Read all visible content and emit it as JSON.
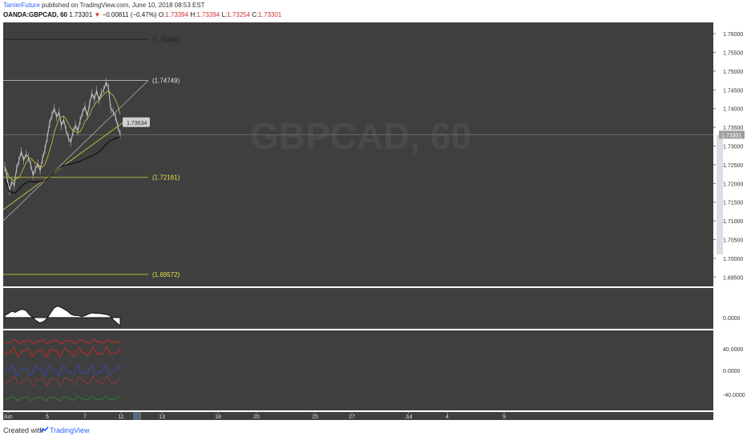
{
  "header": {
    "author": "TarrierFuture",
    "published_text": " published on TradingView.com, June 10, 2018 08:53 EST",
    "symbol": "OANDA:GBPCAD, 60",
    "last": "1.73301",
    "down_arrow": "▼",
    "change": "−0.00811 (−0.47%)",
    "o_label": "O:",
    "o_value": "1.73394",
    "h_label": "H:",
    "h_value": "1.73394",
    "l_label": "L:",
    "l_value": "1.73254",
    "c_label": "C:",
    "c_value": "1.73301"
  },
  "watermark": "GBPCAD, 60",
  "footer": {
    "created_with": "Created with",
    "brand": "TradingView"
  },
  "colors": {
    "bg": "#3f3f3f",
    "candle": "#9a9a9a",
    "yellow": "#c9c93a",
    "ma_dark": "#111111",
    "axis_bg": "#ffffff",
    "indicator_red": "#c62828",
    "indicator_blue": "#3949ab",
    "indicator_green": "#2e7d32"
  },
  "chart_data": {
    "type": "line",
    "title": "",
    "x_ticks": [
      "Jun",
      "5",
      "7",
      "11",
      "13",
      "18",
      "20",
      "25",
      "27",
      "Jul",
      "4",
      "9"
    ],
    "y_ticks": [
      "1.76000",
      "1.75500",
      "1.75000",
      "1.74500",
      "1.74000",
      "1.73500",
      "1.73000",
      "1.72500",
      "1.72000",
      "1.71500",
      "1.71000",
      "1.70500",
      "1.70000",
      "1.69500"
    ],
    "ylim": [
      1.6925,
      1.763
    ],
    "current_price": "1.73301",
    "levels": [
      {
        "label": "(1.75846)",
        "value": 1.75846,
        "color": "dark"
      },
      {
        "label": "(1.74749)",
        "value": 1.74749,
        "color": "light"
      },
      {
        "label": "(1.72161)",
        "value": 1.72161,
        "color": "yellow"
      },
      {
        "label": "(1.69572)",
        "value": 1.69572,
        "color": "yellow"
      }
    ],
    "callout": {
      "label": "1.73634",
      "value": 1.73634
    },
    "series": [
      {
        "values": [
          1.7245,
          1.7215,
          1.718,
          1.7205,
          1.7195,
          1.724,
          1.726,
          1.7285,
          1.7262,
          1.7278,
          1.727,
          1.725,
          1.7222,
          1.7238,
          1.7252,
          1.7235,
          1.7265,
          1.729,
          1.7322,
          1.736,
          1.7382,
          1.74,
          1.7378,
          1.739,
          1.7355,
          1.737,
          1.7342,
          1.7322,
          1.731,
          1.7338,
          1.7355,
          1.734,
          1.7368,
          1.739,
          1.7405,
          1.738,
          1.7412,
          1.744,
          1.7425,
          1.7448,
          1.7422,
          1.7442,
          1.745,
          1.747,
          1.7455,
          1.74,
          1.7392,
          1.7378,
          1.7352,
          1.733
        ]
      }
    ],
    "oscillator": {
      "y_ticks": [
        "0.0000"
      ],
      "values": [
        0.2,
        0.4,
        0.6,
        0.5,
        0.7,
        0.8,
        0.7,
        0.3,
        0.0,
        -0.3,
        -0.5,
        -0.4,
        -0.1,
        0.4,
        0.9,
        1.1,
        1.0,
        0.8,
        0.6,
        0.3,
        0.2,
        0.2,
        0.1,
        0.2,
        0.35,
        0.45,
        0.4,
        0.4,
        0.35,
        0.3,
        0.2,
        -0.2,
        -0.5,
        -0.8
      ]
    },
    "dmi": {
      "y_ticks": [
        "40.0000",
        "0.0000",
        "-40.0000"
      ]
    }
  }
}
